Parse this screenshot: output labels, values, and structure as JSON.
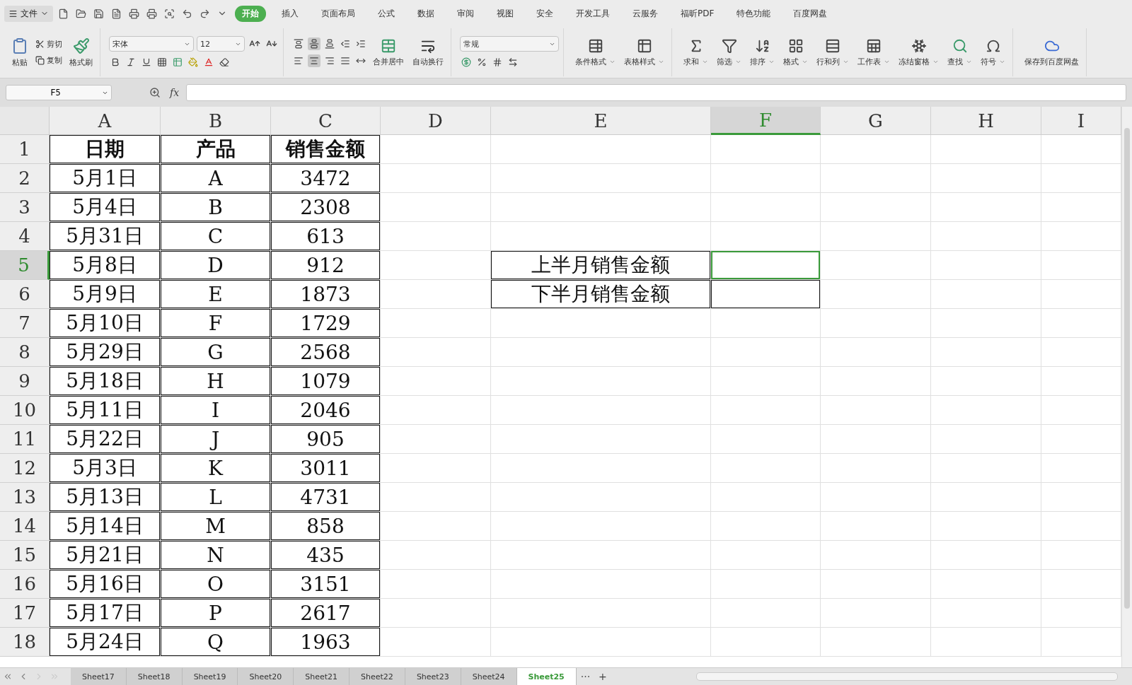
{
  "menu_bar": {
    "file_menu": "文件",
    "tabs": [
      {
        "label": "开始",
        "selected": true
      },
      {
        "label": "插入",
        "selected": false
      },
      {
        "label": "页面布局",
        "selected": false
      },
      {
        "label": "公式",
        "selected": false
      },
      {
        "label": "数据",
        "selected": false
      },
      {
        "label": "审阅",
        "selected": false
      },
      {
        "label": "视图",
        "selected": false
      },
      {
        "label": "安全",
        "selected": false
      },
      {
        "label": "开发工具",
        "selected": false
      },
      {
        "label": "云服务",
        "selected": false
      },
      {
        "label": "福昕PDF",
        "selected": false
      },
      {
        "label": "特色功能",
        "selected": false
      },
      {
        "label": "百度网盘",
        "selected": false
      }
    ]
  },
  "ribbon": {
    "paste": "粘贴",
    "cut": "剪切",
    "copy": "复制",
    "format_painter": "格式刷",
    "font_name": "宋体",
    "font_size": "12",
    "align_buttons": [
      {
        "selected": false
      },
      {
        "selected": true
      },
      {
        "selected": false
      },
      {
        "selected": false
      },
      {
        "selected": false
      },
      {
        "selected": false
      },
      {
        "selected": true
      },
      {
        "selected": false
      },
      {
        "selected": false
      },
      {
        "selected": false
      }
    ],
    "merge": "合并居中",
    "wrap": "自动换行",
    "number_format": "常规",
    "tools": [
      {
        "label": "条件格式",
        "dropdown": true
      },
      {
        "label": "表格样式",
        "dropdown": true
      },
      {
        "label": "求和",
        "dropdown": true
      },
      {
        "label": "筛选",
        "dropdown": true
      },
      {
        "label": "排序",
        "dropdown": true
      },
      {
        "label": "格式",
        "dropdown": true
      },
      {
        "label": "行和列",
        "dropdown": true
      },
      {
        "label": "工作表",
        "dropdown": true
      },
      {
        "label": "冻结窗格",
        "dropdown": true
      },
      {
        "label": "查找",
        "dropdown": true
      },
      {
        "label": "符号",
        "dropdown": true
      }
    ],
    "save_to_cloud": "保存到百度网盘"
  },
  "formula_bar": {
    "cell_ref": "F5",
    "fx": "fx"
  },
  "sheet": {
    "columns": [
      {
        "label": "A",
        "selected": false
      },
      {
        "label": "B",
        "selected": false
      },
      {
        "label": "C",
        "selected": false
      },
      {
        "label": "D",
        "selected": false
      },
      {
        "label": "E",
        "selected": false
      },
      {
        "label": "F",
        "selected": true
      },
      {
        "label": "G",
        "selected": false
      },
      {
        "label": "H",
        "selected": false
      },
      {
        "label": "I",
        "selected": false
      }
    ],
    "rows": [
      {
        "number": "1",
        "selected": false,
        "cells": [
          {
            "text": "日期",
            "bordered": true,
            "bold": true
          },
          {
            "text": "产品",
            "bordered": true,
            "bold": true
          },
          {
            "text": "销售金额",
            "bordered": true,
            "bold": true
          }
        ]
      },
      {
        "number": "2",
        "selected": false,
        "cells": [
          {
            "text": "5月1日",
            "bordered": true
          },
          {
            "text": "A",
            "bordered": true
          },
          {
            "text": "3472",
            "bordered": true
          }
        ]
      },
      {
        "number": "3",
        "selected": false,
        "cells": [
          {
            "text": "5月4日",
            "bordered": true
          },
          {
            "text": "B",
            "bordered": true
          },
          {
            "text": "2308",
            "bordered": true
          }
        ]
      },
      {
        "number": "4",
        "selected": false,
        "cells": [
          {
            "text": "5月31日",
            "bordered": true
          },
          {
            "text": "C",
            "bordered": true
          },
          {
            "text": "613",
            "bordered": true
          }
        ]
      },
      {
        "number": "5",
        "selected": true,
        "cells": [
          {
            "text": "5月8日",
            "bordered": true
          },
          {
            "text": "D",
            "bordered": true
          },
          {
            "text": "912",
            "bordered": true
          },
          null,
          {
            "text": "上半月销售金额",
            "bordered": true
          },
          {
            "bordered": true
          }
        ]
      },
      {
        "number": "6",
        "selected": false,
        "cells": [
          {
            "text": "5月9日",
            "bordered": true
          },
          {
            "text": "E",
            "bordered": true
          },
          {
            "text": "1873",
            "bordered": true
          },
          null,
          {
            "text": "下半月销售金额",
            "bordered": true
          },
          {
            "bordered": true
          }
        ]
      },
      {
        "number": "7",
        "selected": false,
        "cells": [
          {
            "text": "5月10日",
            "bordered": true
          },
          {
            "text": "F",
            "bordered": true
          },
          {
            "text": "1729",
            "bordered": true
          }
        ]
      },
      {
        "number": "8",
        "selected": false,
        "cells": [
          {
            "text": "5月29日",
            "bordered": true
          },
          {
            "text": "G",
            "bordered": true
          },
          {
            "text": "2568",
            "bordered": true
          }
        ]
      },
      {
        "number": "9",
        "selected": false,
        "cells": [
          {
            "text": "5月18日",
            "bordered": true
          },
          {
            "text": "H",
            "bordered": true
          },
          {
            "text": "1079",
            "bordered": true
          }
        ]
      },
      {
        "number": "10",
        "selected": false,
        "cells": [
          {
            "text": "5月11日",
            "bordered": true
          },
          {
            "text": "I",
            "bordered": true
          },
          {
            "text": "2046",
            "bordered": true
          }
        ]
      },
      {
        "number": "11",
        "selected": false,
        "cells": [
          {
            "text": "5月22日",
            "bordered": true
          },
          {
            "text": "J",
            "bordered": true
          },
          {
            "text": "905",
            "bordered": true
          }
        ]
      },
      {
        "number": "12",
        "selected": false,
        "cells": [
          {
            "text": "5月3日",
            "bordered": true
          },
          {
            "text": "K",
            "bordered": true
          },
          {
            "text": "3011",
            "bordered": true
          }
        ]
      },
      {
        "number": "13",
        "selected": false,
        "cells": [
          {
            "text": "5月13日",
            "bordered": true
          },
          {
            "text": "L",
            "bordered": true
          },
          {
            "text": "4731",
            "bordered": true
          }
        ]
      },
      {
        "number": "14",
        "selected": false,
        "cells": [
          {
            "text": "5月14日",
            "bordered": true
          },
          {
            "text": "M",
            "bordered": true
          },
          {
            "text": "858",
            "bordered": true
          }
        ]
      },
      {
        "number": "15",
        "selected": false,
        "cells": [
          {
            "text": "5月21日",
            "bordered": true
          },
          {
            "text": "N",
            "bordered": true
          },
          {
            "text": "435",
            "bordered": true
          }
        ]
      },
      {
        "number": "16",
        "selected": false,
        "cells": [
          {
            "text": "5月16日",
            "bordered": true
          },
          {
            "text": "O",
            "bordered": true
          },
          {
            "text": "3151",
            "bordered": true
          }
        ]
      },
      {
        "number": "17",
        "selected": false,
        "cells": [
          {
            "text": "5月17日",
            "bordered": true
          },
          {
            "text": "P",
            "bordered": true
          },
          {
            "text": "2617",
            "bordered": true
          }
        ]
      },
      {
        "number": "18",
        "selected": false,
        "cells": [
          {
            "text": "5月24日",
            "bordered": true
          },
          {
            "text": "Q",
            "bordered": true
          },
          {
            "text": "1963",
            "bordered": true
          }
        ]
      }
    ]
  },
  "sheet_tabs": {
    "tabs": [
      {
        "label": "Sheet17",
        "selected": false
      },
      {
        "label": "Sheet18",
        "selected": false
      },
      {
        "label": "Sheet19",
        "selected": false
      },
      {
        "label": "Sheet20",
        "selected": false
      },
      {
        "label": "Sheet21",
        "selected": false
      },
      {
        "label": "Sheet22",
        "selected": false
      },
      {
        "label": "Sheet23",
        "selected": false
      },
      {
        "label": "Sheet24",
        "selected": false
      },
      {
        "label": "Sheet25",
        "selected": true
      }
    ],
    "more": "···",
    "add": "+"
  }
}
